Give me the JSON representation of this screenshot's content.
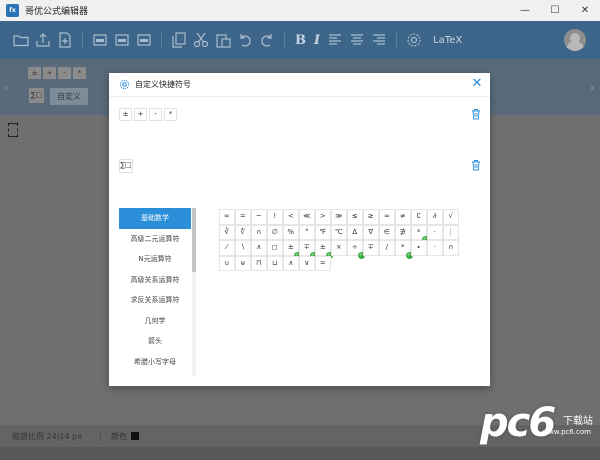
{
  "window": {
    "title": "哥优公式编辑器",
    "app_icon_text": "fx",
    "minimize": "—",
    "maximize": "☐",
    "close": "✕"
  },
  "toolbar": {
    "bold": "B",
    "italic": "I",
    "latex": "LaTeX",
    "icons": [
      "folder-icon",
      "upload-icon",
      "add-file-icon",
      "image-export-icon",
      "image-export-icon",
      "image-export-icon",
      "copy-icon",
      "cut-icon",
      "paste-icon",
      "undo-icon",
      "redo-icon",
      "align-left-icon",
      "align-center-icon",
      "align-right-icon",
      "settings-icon",
      "avatar"
    ]
  },
  "strip": {
    "keys": [
      "±",
      "+",
      "-",
      "*"
    ],
    "sum": "∑□",
    "custom": "自定义"
  },
  "status": {
    "zoom": "缩放比例 24|14 px",
    "color_label": "颜色"
  },
  "watermark": {
    "letters": "pc6",
    "sub": "下载站",
    "url": "www.pc6.com"
  },
  "dialog": {
    "title": "自定义快捷符号",
    "close": "✕",
    "row1": [
      "±",
      "+",
      "-",
      "*"
    ],
    "row2": [
      "∑□"
    ],
    "categories": [
      "基础数学",
      "高级二元运算符",
      "N元运算符",
      "高级关系运算符",
      "求反关系运算符",
      "几何学",
      "箭头",
      "希腊小写字母"
    ],
    "active_category": 0,
    "symbols": [
      [
        "∞",
        "=",
        "~",
        "!",
        "<",
        "≪",
        ">",
        "≫",
        "≤",
        "≥",
        "≈",
        "≠",
        "∁",
        "∂",
        "√"
      ],
      [
        "∛",
        "∜",
        "∩",
        "∅",
        "%",
        "°",
        "℉",
        "℃",
        "∆",
        "∇",
        "∈",
        "∌",
        "*",
        "·",
        "⋮"
      ],
      [
        "⁄",
        "∖",
        "∧",
        "◻",
        "±",
        "∓",
        "±",
        "×",
        "÷",
        "∓",
        "/",
        "*",
        "∙",
        "·",
        "∩"
      ],
      [
        "∪",
        "⊎",
        "⊓",
        "⊔",
        "∧",
        "∨",
        "="
      ]
    ],
    "checked": [
      [
        2,
        4
      ],
      [
        2,
        5
      ],
      [
        2,
        6
      ],
      [
        2,
        8
      ],
      [
        2,
        11
      ],
      [
        1,
        12
      ]
    ],
    "accent_color": "#2b8ed8",
    "check_color": "#3fb049"
  }
}
